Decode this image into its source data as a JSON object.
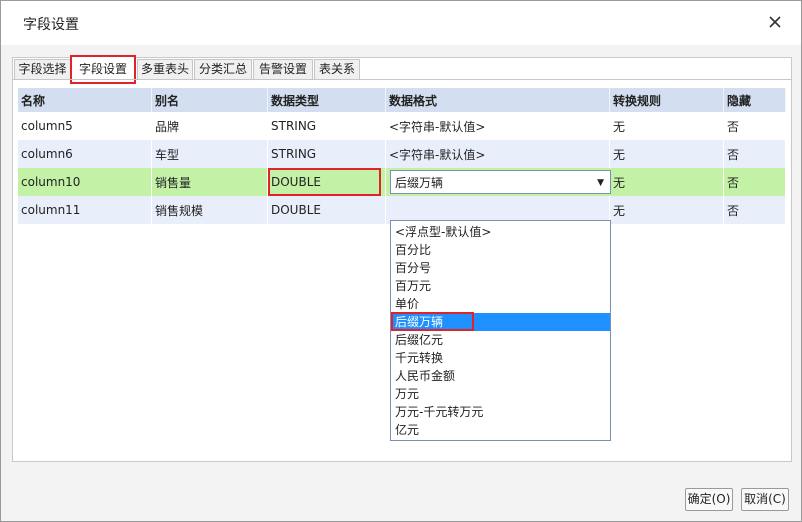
{
  "dialog": {
    "title": "字段设置",
    "close_icon": "close-icon"
  },
  "tabs": [
    {
      "label": "字段选择",
      "active": false
    },
    {
      "label": "字段设置",
      "active": true
    },
    {
      "label": "多重表头",
      "active": false
    },
    {
      "label": "分类汇总",
      "active": false
    },
    {
      "label": "告警设置",
      "active": false
    },
    {
      "label": "表关系",
      "active": false
    }
  ],
  "table": {
    "headers": [
      "名称",
      "别名",
      "数据类型",
      "数据格式",
      "转换规则",
      "隐藏"
    ],
    "rows": [
      [
        "column5",
        "品牌",
        "STRING",
        "<字符串-默认值>",
        "无",
        "否"
      ],
      [
        "column6",
        "车型",
        "STRING",
        "<字符串-默认值>",
        "无",
        "否"
      ],
      [
        "column10",
        "销售量",
        "DOUBLE",
        "后缀万辆",
        "无",
        "否"
      ],
      [
        "column11",
        "销售规模",
        "DOUBLE",
        "",
        "无",
        "否"
      ]
    ]
  },
  "format_select": {
    "value": "后缀万辆",
    "options": [
      "<浮点型-默认值>",
      "百分比",
      "百分号",
      "百万元",
      "单价",
      "后缀万辆",
      "后缀亿元",
      "千元转换",
      "人民币金额",
      "万元",
      "万元-千元转万元",
      "亿元"
    ],
    "selected_index": 5
  },
  "buttons": {
    "ok": "确定(O)",
    "cancel": "取消(C)"
  },
  "colors": {
    "accent_red": "#e0232a",
    "selected_blue": "#1e90ff",
    "active_row": "#c3f2a6",
    "header_bg": "#d3dff0"
  }
}
